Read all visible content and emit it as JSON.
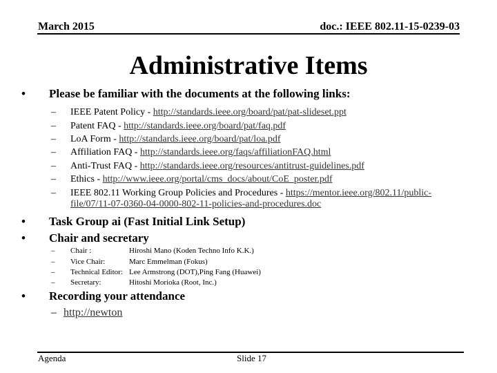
{
  "header": {
    "date": "March 2015",
    "doc_id": "doc.: IEEE 802.11-15-0239-03"
  },
  "title": "Administrative Items",
  "sections": {
    "links_heading": "Please be familiar with the documents at the following links:",
    "links": [
      {
        "label": "IEEE Patent Policy - ",
        "url": "http://standards.ieee.org/board/pat/pat-slideset.ppt"
      },
      {
        "label": "Patent FAQ - ",
        "url": "http://standards.ieee.org/board/pat/faq.pdf"
      },
      {
        "label": "LoA Form - ",
        "url": "http://standards.ieee.org/board/pat/loa.pdf"
      },
      {
        "label": "Affiliation FAQ - ",
        "url": "http://standards.ieee.org/faqs/affiliationFAQ.html"
      },
      {
        "label": "Anti-Trust FAQ - ",
        "url": "http://standards.ieee.org/resources/antitrust-guidelines.pdf"
      },
      {
        "label": "Ethics - ",
        "url": "http://www.ieee.org/portal/cms_docs/about/CoE_poster.pdf"
      },
      {
        "label": "IEEE 802.11 Working Group Policies and Procedures - ",
        "url_line1": "https://mentor.ieee.org/802.11/public-",
        "url_line2": "file/07/11-07-0360-04-0000-802-11-policies-and-procedures.doc"
      }
    ],
    "task_group": "Task Group ai (Fast Initial Link Setup)",
    "chair_heading": "Chair and secretary",
    "officers": [
      {
        "role": "Chair :",
        "name": "Hiroshi Mano (Koden Techno Info K.K.)"
      },
      {
        "role": "Vice Chair:",
        "name": "Marc Emmelman (Fokus)"
      },
      {
        "role": "Technical  Editor:",
        "name": "Lee Armstrong (DOT),Ping Fang (Huawei)"
      },
      {
        "role": "Secretary:",
        "name": "Hitoshi Morioka (Root, Inc.)"
      }
    ],
    "attendance_heading": "Recording your attendance",
    "attendance_link": "http://newton"
  },
  "symbols": {
    "bullet": "•",
    "dash": "–"
  },
  "footer": {
    "left": "Agenda",
    "center": "Slide 17"
  }
}
